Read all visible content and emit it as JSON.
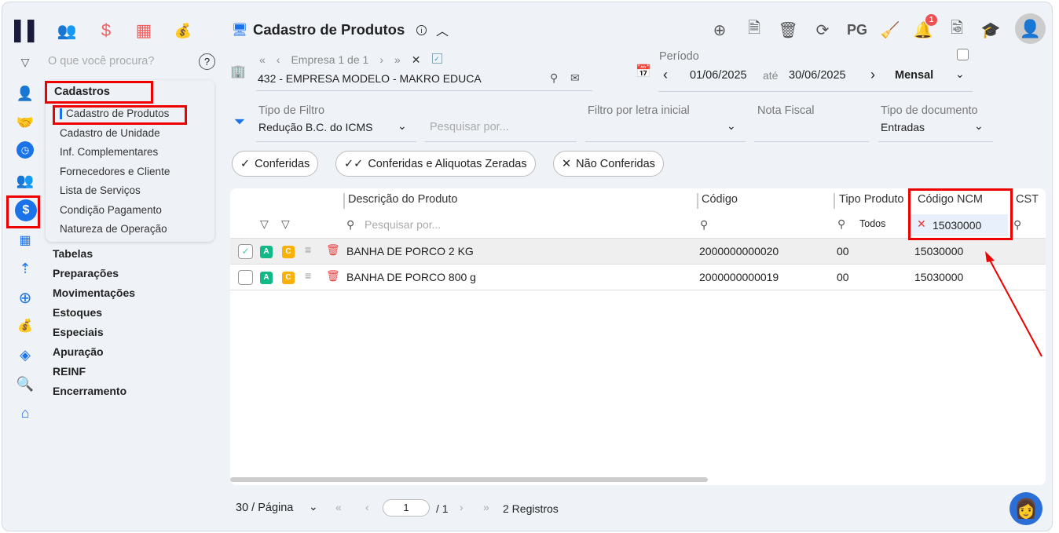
{
  "header": {
    "title": "Cadastro de Produtos",
    "pg_label": "PG",
    "notification_count": "1"
  },
  "search": {
    "placeholder": "O que você procura?",
    "help": "?"
  },
  "menu": {
    "section": "Cadastros",
    "items": [
      "Cadastro de Produtos",
      "Cadastro de Unidade",
      "Inf. Complementares",
      "Fornecedores e Cliente",
      "Lista de Serviços",
      "Condição Pagamento",
      "Natureza de Operação"
    ]
  },
  "sections": [
    "Tabelas",
    "Preparações",
    "Movimentações",
    "Estoques",
    "Especiais",
    "Apuração",
    "REINF",
    "Encerramento"
  ],
  "empresa": {
    "nav": "Empresa 1 de 1",
    "value": "432 - EMPRESA MODELO - MAKRO EDUCA"
  },
  "periodo": {
    "label": "Período",
    "from": "01/06/2025",
    "sep": "até",
    "to": "30/06/2025",
    "mode": "Mensal"
  },
  "filters": {
    "tipo_label": "Tipo de Filtro",
    "tipo_value": "Redução B.C. do ICMS",
    "search_placeholder": "Pesquisar por...",
    "letra_label": "Filtro por letra inicial",
    "nf_label": "Nota Fiscal",
    "doc_label": "Tipo de documento",
    "doc_value": "Entradas"
  },
  "chips": [
    "Conferidas",
    "Conferidas e Aliquotas Zeradas",
    "Não Conferidas"
  ],
  "table": {
    "columns": [
      "Descrição do Produto",
      "Código",
      "Tipo Produto",
      "Código NCM",
      "CST"
    ],
    "desc_placeholder": "Pesquisar por...",
    "tipo_filter": "Todos",
    "ncm_filter": "15030000",
    "rows": [
      {
        "desc": "BANHA DE PORCO 2 KG",
        "codigo": "2000000000020",
        "tipo": "00",
        "ncm": "15030000",
        "checked": true
      },
      {
        "desc": "BANHA DE PORCO 800 g",
        "codigo": "2000000000019",
        "tipo": "00",
        "ncm": "15030000",
        "checked": false
      }
    ]
  },
  "pager": {
    "per_page": "30 / Página",
    "page": "1",
    "total_pages": "/ 1",
    "records": "2 Registros"
  },
  "colors": {
    "accent": "#1a73e8",
    "red": "#e00000",
    "green": "#12b886",
    "orange": "#fab005"
  }
}
